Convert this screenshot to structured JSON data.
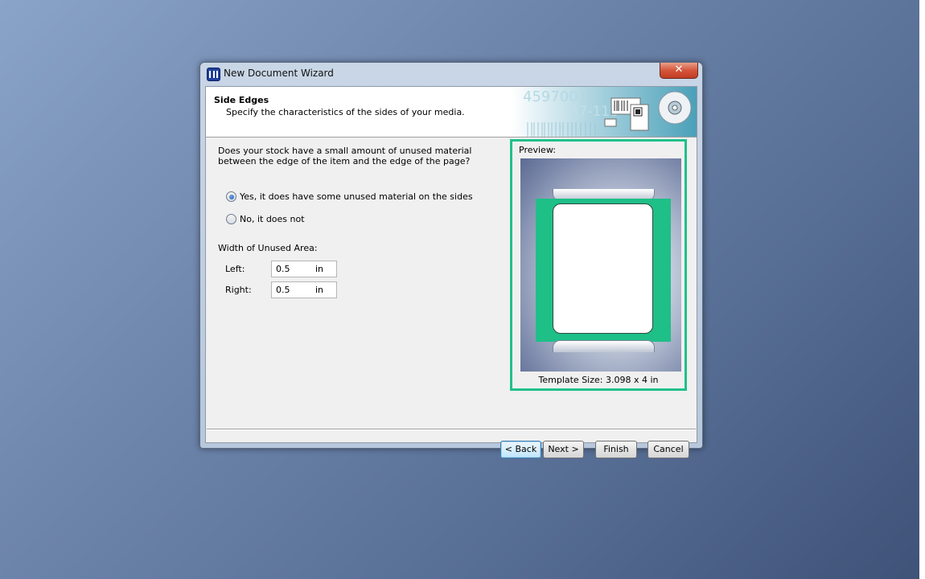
{
  "window": {
    "title": "New Document Wizard",
    "close_label": "✕"
  },
  "header": {
    "title": "Side Edges",
    "subtitle": "Specify the characteristics of the sides of your media.",
    "banner_texts": [
      "4597001",
      "A7-118"
    ]
  },
  "content": {
    "question": "Does your stock have a small amount of unused material between the edge of the item and the edge of the page?",
    "options": [
      {
        "label": "Yes, it does have some unused material on the sides",
        "selected": true
      },
      {
        "label": "No, it does not",
        "selected": false
      }
    ],
    "width_label": "Width of Unused Area:",
    "fields": [
      {
        "label": "Left:",
        "value": "0.5",
        "unit": "in"
      },
      {
        "label": "Right:",
        "value": "0.5",
        "unit": "in"
      }
    ]
  },
  "preview": {
    "label": "Preview:",
    "template_size": "Template Size:  3.098 x 4 in"
  },
  "buttons": {
    "back": "< Back",
    "next": "Next  >",
    "finish": "Finish",
    "cancel": "Cancel"
  },
  "colors": {
    "highlight": "#21c08a",
    "stock": "#1fbf88"
  }
}
